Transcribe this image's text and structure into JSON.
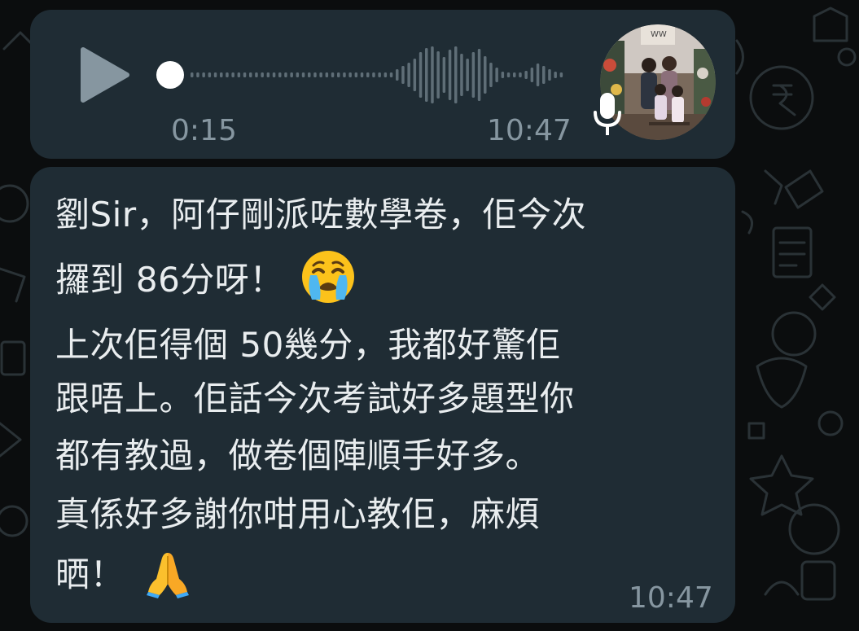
{
  "voice_message": {
    "duration": "0:15",
    "time": "10:47",
    "progress": 0.0,
    "avatar_icon": "family-photo-avatar",
    "mic_icon": "microphone-icon",
    "play_icon": "play-icon"
  },
  "text_message": {
    "lines": [
      "劉Sir，阿仔剛派咗數學卷，佢今次",
      "攞到 86分呀！",
      "上次佢得個 50幾分，我都好驚佢",
      "跟唔上。佢話今次考試好多題型你",
      "都有教過，做卷個陣順手好多。",
      "真係好多謝你咁用心教佢，麻煩",
      "晒！"
    ],
    "emoji_crying": "loudly-crying-face-emoji",
    "emoji_pray": "folded-hands-emoji",
    "time": "10:47"
  },
  "colors": {
    "background": "#0b0d0e",
    "bubble": "#1f2c34",
    "text": "#e9edef",
    "meta": "#8696a0"
  }
}
